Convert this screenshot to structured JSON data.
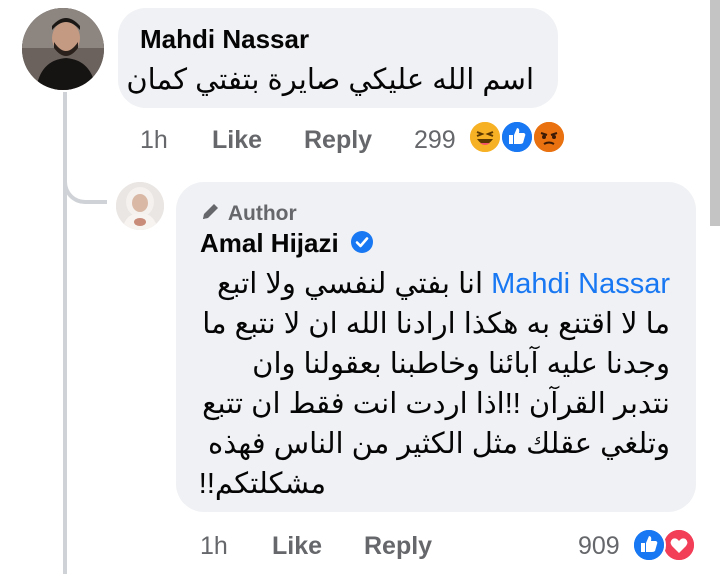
{
  "comment": {
    "author": "Mahdi Nassar",
    "text": "اسم الله عليكي صايرة بتفتي كمان",
    "time": "1h",
    "like_label": "Like",
    "reply_label": "Reply",
    "reaction_count": "299",
    "reactions": [
      "haha-icon",
      "like-icon",
      "angry-icon"
    ]
  },
  "reply": {
    "author_badge": "Author",
    "author": "Amal Hijazi",
    "verified": true,
    "mention": "Mahdi Nassar",
    "line1_rest": "انا بفتي لنفسي ولا اتبع",
    "line2": "ما لا اقتنع به هكذا ارادنا الله ان لا نتبع ما",
    "line3": "وجدنا عليه آبائنا وخاطبنا بعقولنا وان",
    "line4": "نتدبر القرآن !!اذا اردت انت فقط ان تتبع",
    "line5": "وتلغي عقلك مثل الكثير من الناس فهذه",
    "line6": "مشكلتكم!!",
    "time": "1h",
    "like_label": "Like",
    "reply_label": "Reply",
    "reaction_count": "909",
    "reactions": [
      "like-icon",
      "love-icon"
    ]
  },
  "colors": {
    "bubble": "#eff1f4",
    "meta_text": "#65676b",
    "link": "#1877f2",
    "like_blue": "#1877f2",
    "love_red": "#f33e58",
    "haha_yellow": "#f7b125",
    "angry_orange": "#e9710f"
  }
}
